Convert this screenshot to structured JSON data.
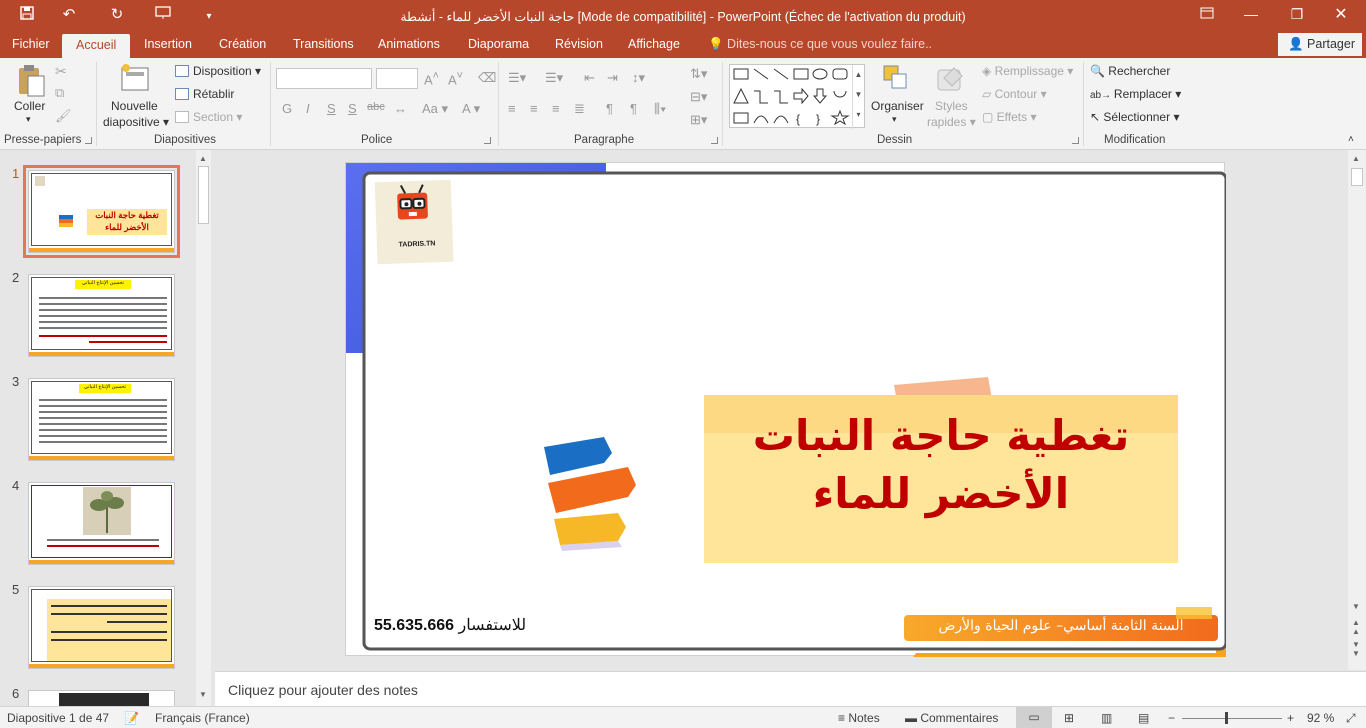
{
  "window": {
    "title": "حاجة النبات الأخضر للماء - أنشطة [Mode de compatibilité] - PowerPoint (Échec de l'activation du produit)"
  },
  "quick_access": [
    "save-icon",
    "undo-icon",
    "redo-icon",
    "present-from-start-icon",
    "customize-icon"
  ],
  "tabs": [
    {
      "label": "Fichier"
    },
    {
      "label": "Accueil",
      "active": true
    },
    {
      "label": "Insertion"
    },
    {
      "label": "Création"
    },
    {
      "label": "Transitions"
    },
    {
      "label": "Animations"
    },
    {
      "label": "Diaporama"
    },
    {
      "label": "Révision"
    },
    {
      "label": "Affichage"
    }
  ],
  "tell_me": "Dites-nous ce que vous voulez faire..",
  "share": "Partager",
  "ribbon": {
    "clipboard": {
      "paste": "Coller",
      "group": "Presse-papiers"
    },
    "slides": {
      "new_slide_1": "Nouvelle",
      "new_slide_2": "diapositive",
      "layout": "Disposition",
      "reset": "Rétablir",
      "section": "Section",
      "group": "Diapositives"
    },
    "font": {
      "bold": "G",
      "italic": "I",
      "underline": "S",
      "strike": "S",
      "spacing": "abc",
      "case": "Aa",
      "group": "Police"
    },
    "paragraph": {
      "group": "Paragraphe"
    },
    "drawing": {
      "arrange": "Organiser",
      "quick_styles_1": "Styles",
      "quick_styles_2": "rapides",
      "fill": "Remplissage",
      "outline": "Contour",
      "effects": "Effets",
      "group": "Dessin"
    },
    "editing": {
      "find": "Rechercher",
      "replace": "Remplacer",
      "select": "Sélectionner",
      "group": "Modification"
    }
  },
  "thumbnails": [
    {
      "number": "1",
      "title": "تغطية حاجة النبات الأخضر للماء"
    },
    {
      "number": "2",
      "title": "تحسين الإنتاج النباتي"
    },
    {
      "number": "3",
      "title": "تحسين الإنتاج النباتي"
    },
    {
      "number": "4"
    },
    {
      "number": "5"
    },
    {
      "number": "6"
    }
  ],
  "slide": {
    "logo_text": "TADRIS.TN",
    "title_line1": "تغطية حاجة النبات",
    "title_line2": "الأخضر للماء",
    "contact_label": "للاستفسار",
    "contact_number": "55.635.666",
    "phone_glyph": "",
    "footer": "السنة الثامنة أساسي– علوم الحياة والأرض"
  },
  "notes_placeholder": "Cliquez pour ajouter des notes",
  "status": {
    "slide_info": "Diapositive 1 de 47",
    "language": "Français (France)",
    "notes": "Notes",
    "comments": "Commentaires",
    "zoom": "92 %"
  },
  "colors": {
    "accent": "#b7472a",
    "slide_title": "#c00000",
    "slide_band": "#ffe59a",
    "orange": "#f7a52b"
  }
}
